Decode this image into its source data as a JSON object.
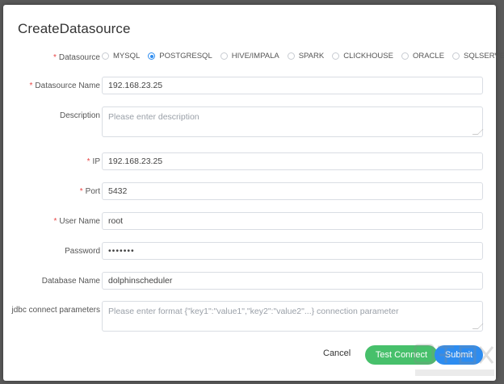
{
  "dialog": {
    "title": "CreateDatasource"
  },
  "form": {
    "datasource": {
      "label": "Datasource",
      "options": [
        "MYSQL",
        "POSTGRESQL",
        "HIVE/IMPALA",
        "SPARK",
        "CLICKHOUSE",
        "ORACLE",
        "SQLSERVER"
      ],
      "selected": "POSTGRESQL"
    },
    "name": {
      "label": "Datasource Name",
      "value": "192.168.23.25"
    },
    "description": {
      "label": "Description",
      "placeholder": "Please enter description"
    },
    "ip": {
      "label": "IP",
      "value": "192.168.23.25"
    },
    "port": {
      "label": "Port",
      "value": "5432"
    },
    "username": {
      "label": "User Name",
      "value": "root"
    },
    "password": {
      "label": "Password",
      "value": "•••••••"
    },
    "database": {
      "label": "Database Name",
      "value": "dolphinscheduler"
    },
    "jdbc": {
      "label": "jdbc connect parameters",
      "placeholder": "Please enter format {\"key1\":\"value1\",\"key2\":\"value2\"...} connection parameter"
    }
  },
  "buttons": {
    "cancel": "Cancel",
    "test": "Test Connect",
    "submit": "Submit"
  },
  "colors": {
    "primary": "#2d8cf0",
    "success": "#47c06b",
    "required": "#e84545"
  }
}
